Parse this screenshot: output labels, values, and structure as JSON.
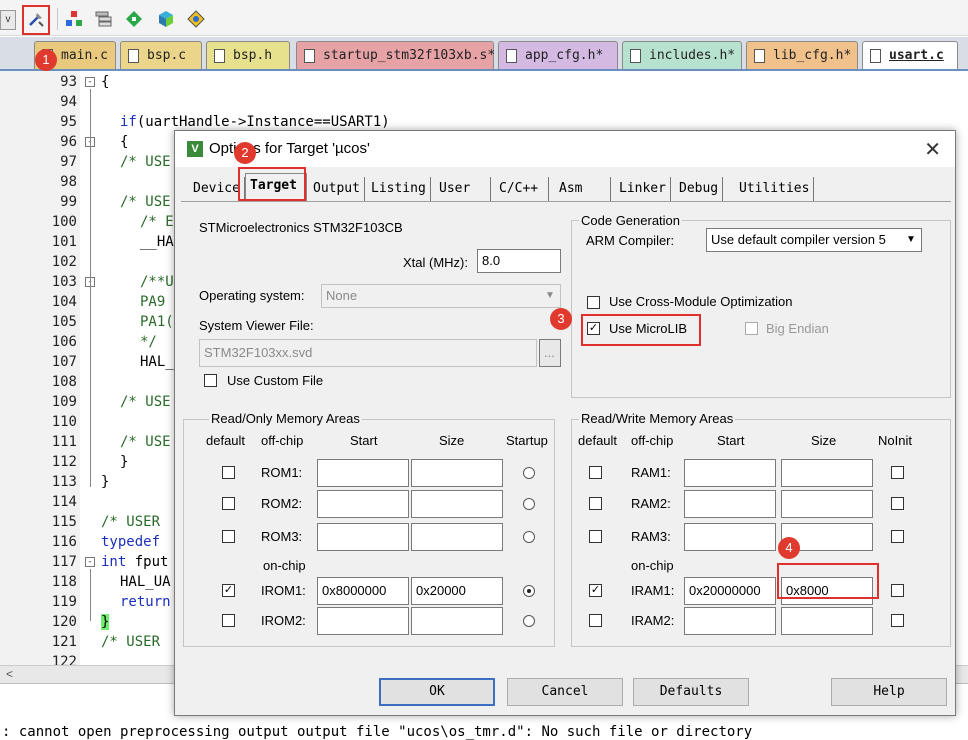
{
  "toolbar": {
    "dropdown": "v",
    "icons": [
      "target-options-icon",
      "manage-components-icon",
      "file-extensions-icon",
      "select-packs-icon",
      "pack-installer-icon",
      "run-time-env-icon"
    ]
  },
  "tabs": [
    "main.c",
    "bsp.c",
    "bsp.h",
    "startup_stm32f103xb.s*",
    "app_cfg.h*",
    "includes.h*",
    "lib_cfg.h*",
    "usart.c"
  ],
  "badges": [
    "1",
    "2",
    "3",
    "4"
  ],
  "editor": {
    "lines": [
      "93",
      "94",
      "95",
      "96",
      "97",
      "98",
      "99",
      "100",
      "101",
      "102",
      "103",
      "104",
      "105",
      "106",
      "107",
      "108",
      "109",
      "110",
      "111",
      "112",
      "113",
      "114",
      "115",
      "116",
      "117",
      "118",
      "119",
      "120",
      "121",
      "122"
    ],
    "code": {
      "l93": "{",
      "l95_kw": "if",
      "l95": "(uartHandle->Instance==USART1)",
      "l96": "{",
      "l97": "/* USE",
      "l99": "/* USE",
      "l100": "/* E",
      "l101": "__HA",
      "l103": "/**U",
      "l104": "PA9",
      "l105": "PA1(",
      "l106": "*/",
      "l107": "HAL_",
      "l109": "/* USE",
      "l111": "/* USE",
      "l112": "}",
      "l113": "}",
      "l115": "/* USER",
      "l116": "typedef",
      "l117_kw": "int",
      "l117": " fput",
      "l118": "HAL_UA",
      "l119": "return",
      "l120": "}",
      "l121": "/* USER"
    },
    "hscroll": "<"
  },
  "status": {
    "message": ": cannot open preprocessing output output file \"ucos\\os_tmr.d\": No such file or directory"
  },
  "dialog": {
    "title": "Options for Target 'µcos'",
    "close": "✕",
    "tabs": [
      "Device",
      "Target",
      "Output",
      "Listing",
      "User",
      "C/C++",
      "Asm",
      "Linker",
      "Debug",
      "Utilities"
    ],
    "device_name": "STMicroelectronics STM32F103CB",
    "xtal_label": "Xtal (MHz):",
    "xtal_value": "8.0",
    "os_label": "Operating system:",
    "os_value": "None",
    "svd_label": "System Viewer File:",
    "svd_value": "STM32F103xx.svd",
    "browse": "...",
    "custom_file": "Use Custom File",
    "codegen": {
      "title": "Code Generation",
      "compiler_label": "ARM Compiler:",
      "compiler_value": "Use default compiler version 5",
      "cross_module": "Use Cross-Module Optimization",
      "microlib": "Use MicroLIB",
      "big_endian": "Big Endian"
    },
    "ro": {
      "title": "Read/Only Memory Areas",
      "headers": [
        "default",
        "off-chip",
        "Start",
        "Size",
        "Startup"
      ],
      "onchip": "on-chip",
      "rows": [
        {
          "name": "ROM1:",
          "start": "",
          "size": ""
        },
        {
          "name": "ROM2:",
          "start": "",
          "size": ""
        },
        {
          "name": "ROM3:",
          "start": "",
          "size": ""
        },
        {
          "name": "IROM1:",
          "start": "0x8000000",
          "size": "0x20000"
        },
        {
          "name": "IROM2:",
          "start": "",
          "size": ""
        }
      ]
    },
    "rw": {
      "title": "Read/Write Memory Areas",
      "headers": [
        "default",
        "off-chip",
        "Start",
        "Size",
        "NoInit"
      ],
      "onchip": "on-chip",
      "rows": [
        {
          "name": "RAM1:",
          "start": "",
          "size": ""
        },
        {
          "name": "RAM2:",
          "start": "",
          "size": ""
        },
        {
          "name": "RAM3:",
          "start": "",
          "size": ""
        },
        {
          "name": "IRAM1:",
          "start": "0x20000000",
          "size": "0x8000"
        },
        {
          "name": "IRAM2:",
          "start": "",
          "size": ""
        }
      ]
    },
    "buttons": {
      "ok": "OK",
      "cancel": "Cancel",
      "defaults": "Defaults",
      "help": "Help"
    },
    "checks": {
      "check": "✓",
      "combo_arrow": "▼"
    }
  }
}
